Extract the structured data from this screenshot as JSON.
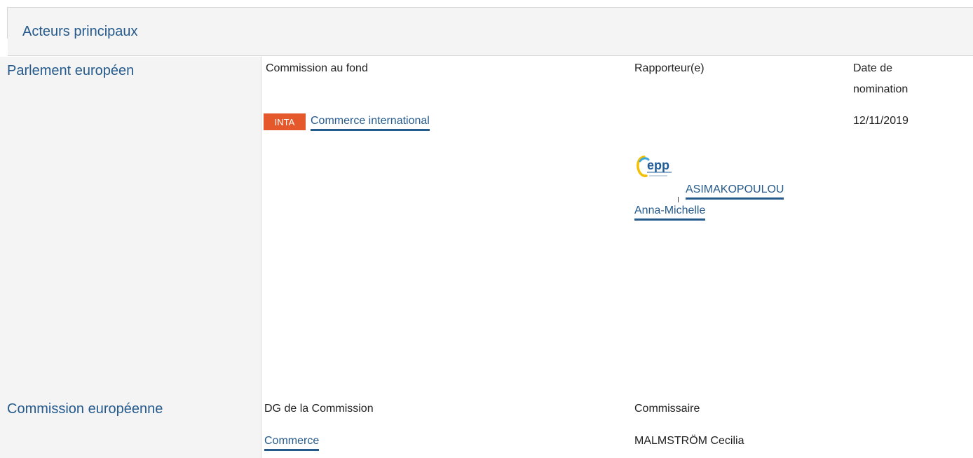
{
  "section_title": "Acteurs principaux",
  "parliament": {
    "label": "Parlement européen",
    "col1_header": "Commission au fond",
    "col2_header": "Rapporteur(e)",
    "col3_header_line1": "Date de",
    "col3_header_line2": "nomination",
    "committee_code": "INTA",
    "committee_name": "Commerce international",
    "appointment_date": "12/11/2019",
    "rapporteur_line1": "ASIMAKOPOULOU",
    "rapporteur_line2": "Anna-Michelle",
    "group_logo_text": "epp"
  },
  "commission": {
    "label": "Commission européenne",
    "col1_header": "DG de la Commission",
    "col2_header": "Commissaire",
    "dg_name": "Commerce",
    "commissioner": "MALMSTRÖM Cecilia"
  },
  "colors": {
    "accent": "#255a8c",
    "badge": "#e4582b",
    "panel": "#f4f4f4"
  }
}
